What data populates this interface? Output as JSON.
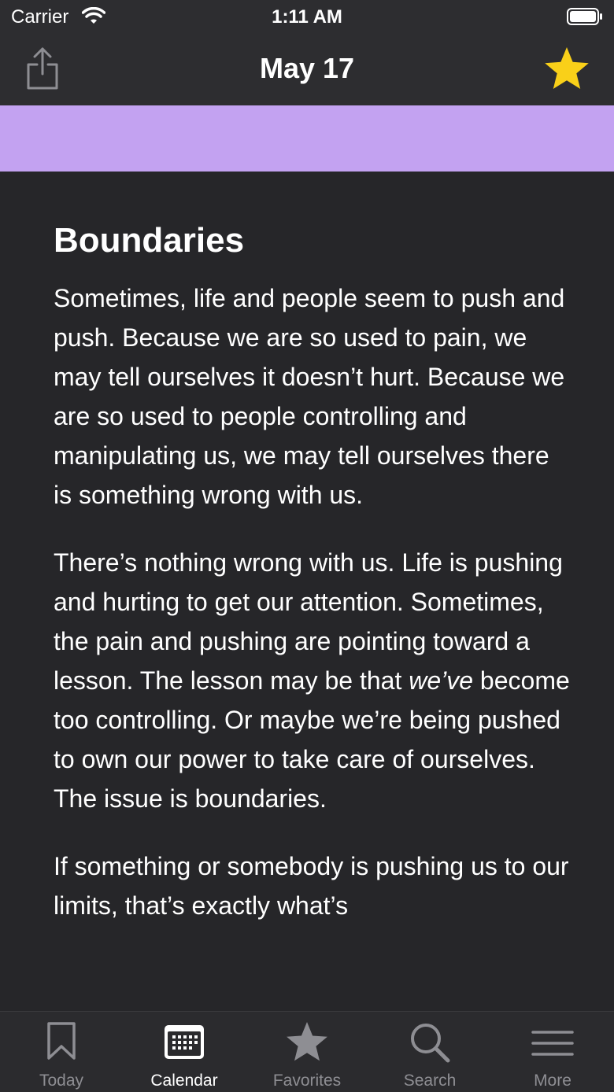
{
  "status": {
    "carrier": "Carrier",
    "time": "1:11 AM"
  },
  "nav": {
    "title": "May 17",
    "star_color": "#f9d019"
  },
  "banner_color": "#c3a2f1",
  "entry": {
    "title": "Boundaries",
    "p1": "Sometimes, life and people seem to push and push. Because we are so used to pain, we may tell ourselves it doesn’t hurt. Because we are so used to people controlling and manipulating us, we may tell ourselves there is something wrong with us.",
    "p2_a": "There’s nothing wrong with us. Life is pushing and hurting to get our attention. Sometimes, the pain and pushing are pointing toward a lesson. The lesson may be that ",
    "p2_em": "we’ve",
    "p2_b": " become too controlling. Or maybe we’re being pushed to own our power to take care of ourselves. The issue is boundaries.",
    "p3": "If something or somebody is pushing us to our limits, that’s exactly what’s"
  },
  "tabs": [
    {
      "label": "Today",
      "icon": "bookmark-icon"
    },
    {
      "label": "Calendar",
      "icon": "calendar-icon"
    },
    {
      "label": "Favorites",
      "icon": "star-icon"
    },
    {
      "label": "Search",
      "icon": "search-icon"
    },
    {
      "label": "More",
      "icon": "menu-icon"
    }
  ],
  "active_tab": "Calendar"
}
